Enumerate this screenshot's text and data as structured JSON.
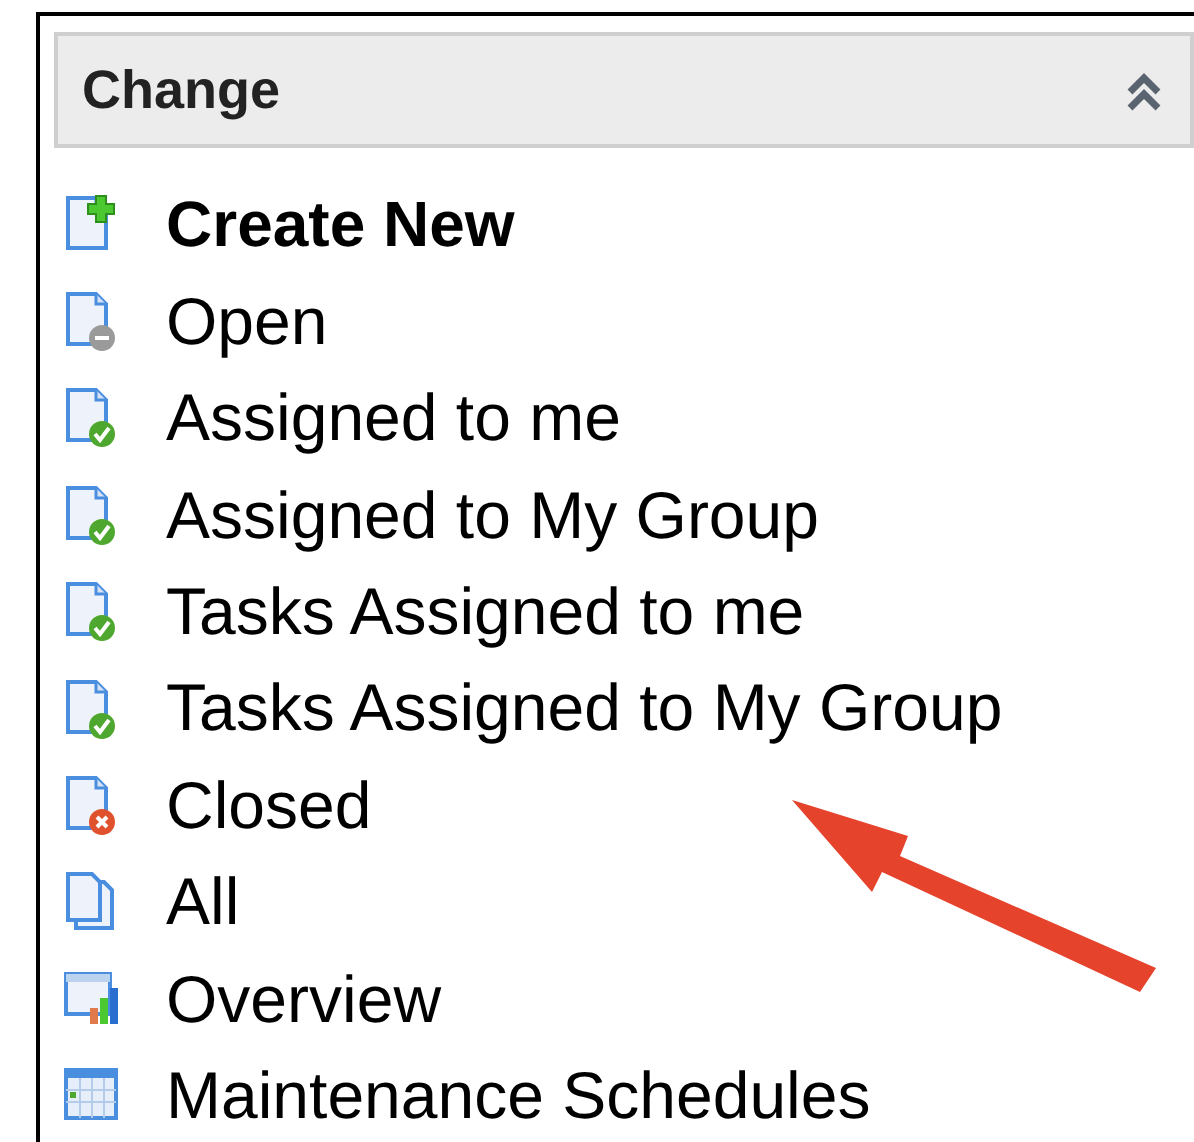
{
  "panel": {
    "title": "Change",
    "expanded": true
  },
  "items": [
    {
      "label": "Create New",
      "kind": "create"
    },
    {
      "label": "Open",
      "kind": "open"
    },
    {
      "label": "Assigned to me",
      "kind": "assigned"
    },
    {
      "label": "Assigned to My Group",
      "kind": "assigned"
    },
    {
      "label": "Tasks Assigned to me",
      "kind": "assigned"
    },
    {
      "label": "Tasks Assigned to My Group",
      "kind": "assigned"
    },
    {
      "label": "Closed",
      "kind": "closed"
    },
    {
      "label": "All",
      "kind": "all"
    },
    {
      "label": "Overview",
      "kind": "overview"
    },
    {
      "label": "Maintenance Schedules",
      "kind": "schedule"
    }
  ]
}
